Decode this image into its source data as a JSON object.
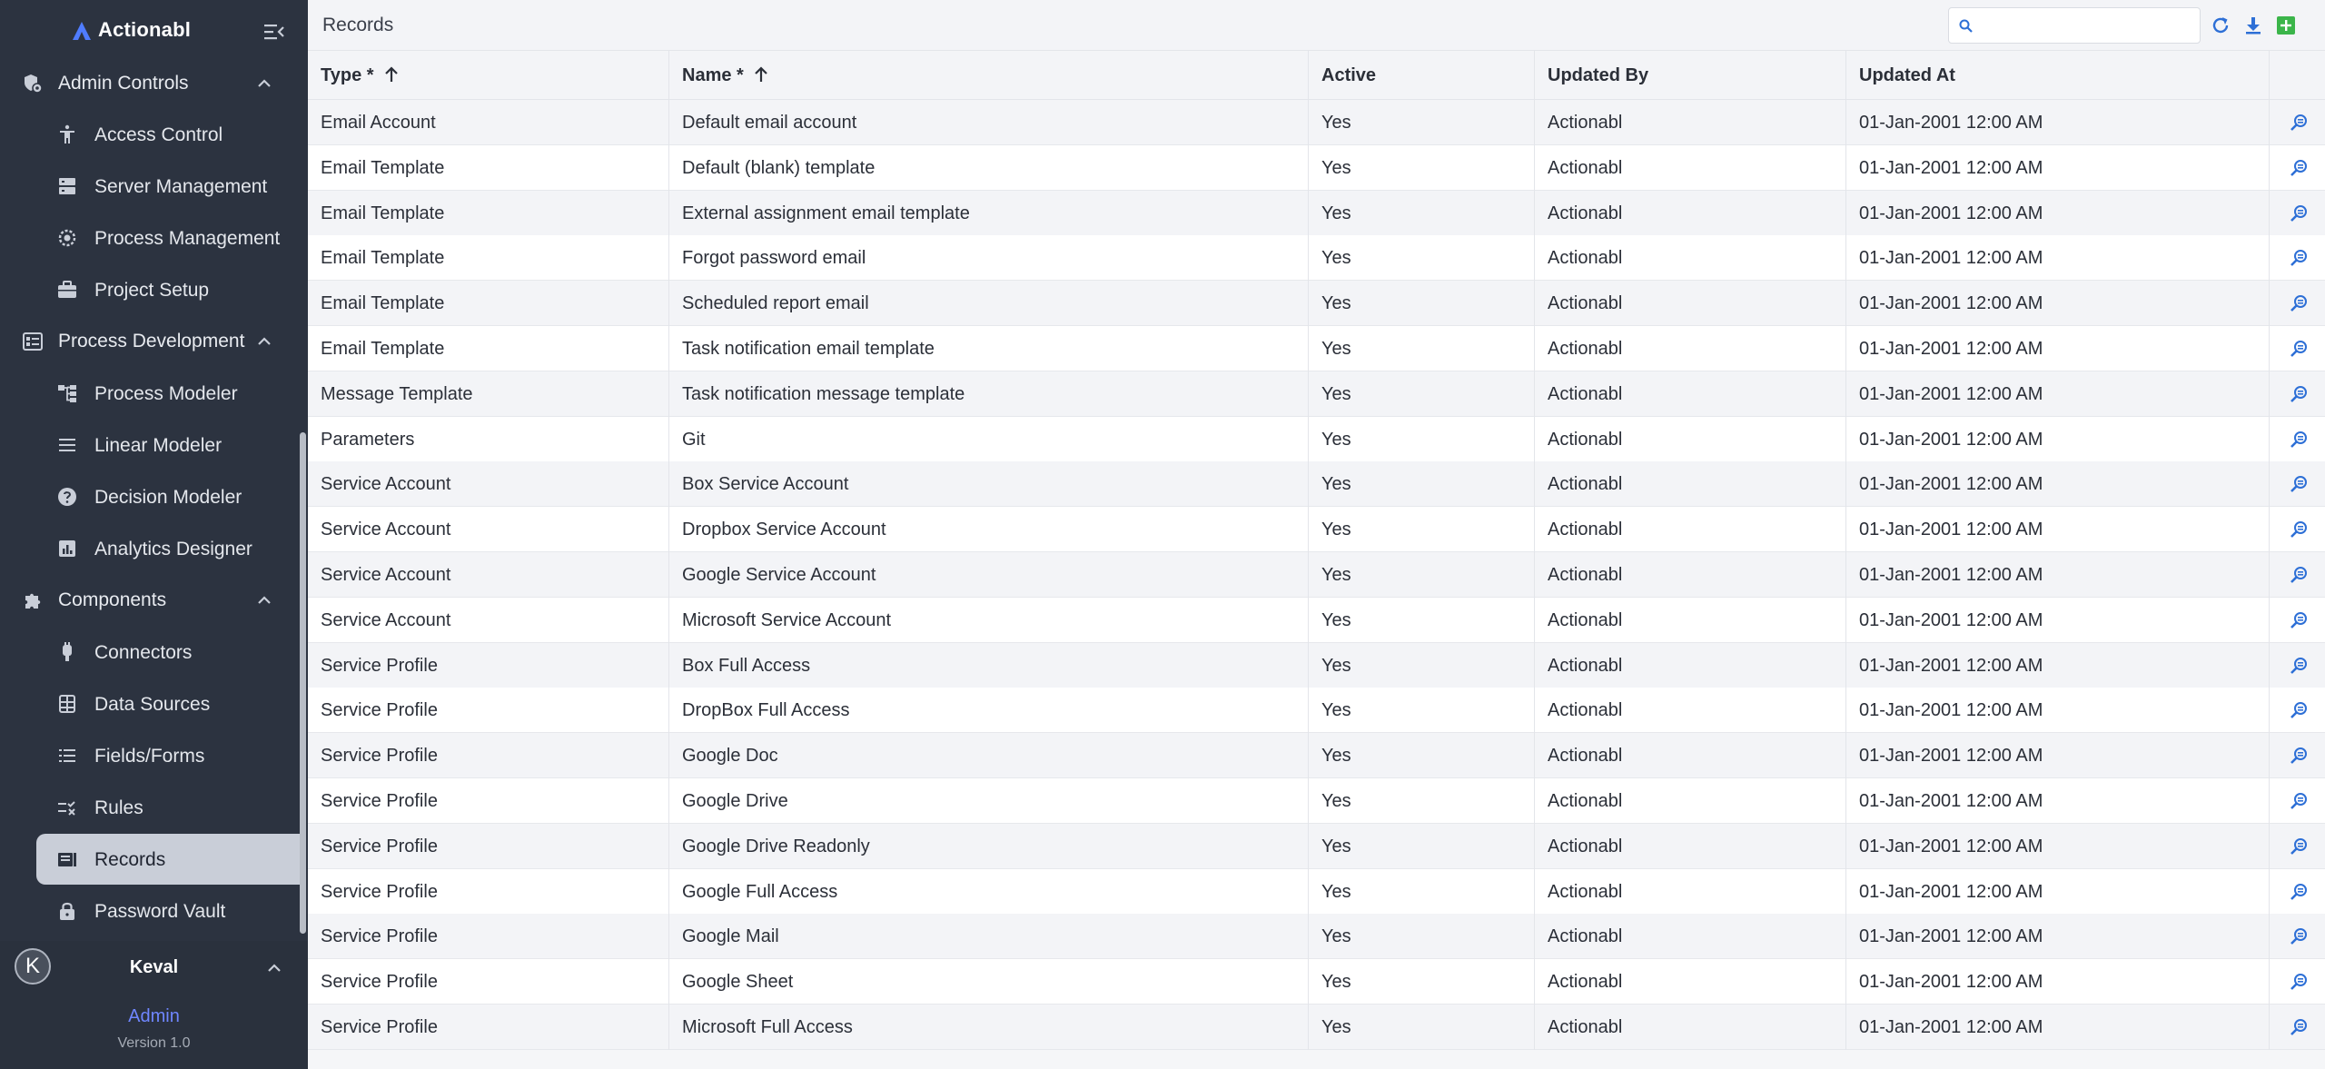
{
  "app": {
    "name": "Actionabl"
  },
  "sidebar": {
    "sections": [
      {
        "label": "Admin Controls",
        "icon": "admin-controls-icon",
        "items": [
          {
            "label": "Access Control",
            "icon": "accessibility-icon"
          },
          {
            "label": "Server Management",
            "icon": "server-icon"
          },
          {
            "label": "Process Management",
            "icon": "process-gear-icon"
          },
          {
            "label": "Project Setup",
            "icon": "briefcase-icon"
          }
        ]
      },
      {
        "label": "Process Development",
        "icon": "process-development-icon",
        "items": [
          {
            "label": "Process Modeler",
            "icon": "hierarchy-icon"
          },
          {
            "label": "Linear Modeler",
            "icon": "lines-icon"
          },
          {
            "label": "Decision Modeler",
            "icon": "help-circle-icon"
          },
          {
            "label": "Analytics Designer",
            "icon": "analytics-icon"
          }
        ]
      },
      {
        "label": "Components",
        "icon": "puzzle-icon",
        "items": [
          {
            "label": "Connectors",
            "icon": "plug-icon"
          },
          {
            "label": "Data Sources",
            "icon": "database-icon"
          },
          {
            "label": "Fields/Forms",
            "icon": "list-icon"
          },
          {
            "label": "Rules",
            "icon": "rule-icon"
          },
          {
            "label": "Records",
            "icon": "book-icon",
            "active": true
          },
          {
            "label": "Password Vault",
            "icon": "lock-icon"
          }
        ]
      }
    ],
    "user": {
      "initial": "K",
      "name": "Keval",
      "role": "Admin",
      "version": "Version 1.0"
    }
  },
  "header": {
    "title": "Records",
    "search": {
      "value": "",
      "placeholder": ""
    },
    "actions": [
      "refresh-icon",
      "download-icon",
      "add-icon"
    ]
  },
  "colors": {
    "sidebar_bg": "#2c3340",
    "accent_add": "#3bb54a",
    "accent_action": "#2d6fd6",
    "role": "#6f86ff"
  },
  "table": {
    "columns": [
      {
        "label": "Type *",
        "sortable": true,
        "sort": "asc"
      },
      {
        "label": "Name *",
        "sortable": true,
        "sort": "asc"
      },
      {
        "label": "Active"
      },
      {
        "label": "Updated By"
      },
      {
        "label": "Updated At"
      }
    ],
    "rows": [
      [
        "Email Account",
        "Default email account",
        "Yes",
        "Actionabl",
        "01-Jan-2001 12:00 AM"
      ],
      [
        "Email Template",
        "Default (blank) template",
        "Yes",
        "Actionabl",
        "01-Jan-2001 12:00 AM"
      ],
      [
        "Email Template",
        "External assignment email template",
        "Yes",
        "Actionabl",
        "01-Jan-2001 12:00 AM"
      ],
      [
        "Email Template",
        "Forgot password email",
        "Yes",
        "Actionabl",
        "01-Jan-2001 12:00 AM"
      ],
      [
        "Email Template",
        "Scheduled report email",
        "Yes",
        "Actionabl",
        "01-Jan-2001 12:00 AM"
      ],
      [
        "Email Template",
        "Task notification email template",
        "Yes",
        "Actionabl",
        "01-Jan-2001 12:00 AM"
      ],
      [
        "Message Template",
        "Task notification message template",
        "Yes",
        "Actionabl",
        "01-Jan-2001 12:00 AM"
      ],
      [
        "Parameters",
        "Git",
        "Yes",
        "Actionabl",
        "01-Jan-2001 12:00 AM"
      ],
      [
        "Service Account",
        "Box Service Account",
        "Yes",
        "Actionabl",
        "01-Jan-2001 12:00 AM"
      ],
      [
        "Service Account",
        "Dropbox Service Account",
        "Yes",
        "Actionabl",
        "01-Jan-2001 12:00 AM"
      ],
      [
        "Service Account",
        "Google Service Account",
        "Yes",
        "Actionabl",
        "01-Jan-2001 12:00 AM"
      ],
      [
        "Service Account",
        "Microsoft Service Account",
        "Yes",
        "Actionabl",
        "01-Jan-2001 12:00 AM"
      ],
      [
        "Service Profile",
        "Box Full Access",
        "Yes",
        "Actionabl",
        "01-Jan-2001 12:00 AM"
      ],
      [
        "Service Profile",
        "DropBox Full Access",
        "Yes",
        "Actionabl",
        "01-Jan-2001 12:00 AM"
      ],
      [
        "Service Profile",
        "Google Doc",
        "Yes",
        "Actionabl",
        "01-Jan-2001 12:00 AM"
      ],
      [
        "Service Profile",
        "Google Drive",
        "Yes",
        "Actionabl",
        "01-Jan-2001 12:00 AM"
      ],
      [
        "Service Profile",
        "Google Drive Readonly",
        "Yes",
        "Actionabl",
        "01-Jan-2001 12:00 AM"
      ],
      [
        "Service Profile",
        "Google Full Access",
        "Yes",
        "Actionabl",
        "01-Jan-2001 12:00 AM"
      ],
      [
        "Service Profile",
        "Google Mail",
        "Yes",
        "Actionabl",
        "01-Jan-2001 12:00 AM"
      ],
      [
        "Service Profile",
        "Google Sheet",
        "Yes",
        "Actionabl",
        "01-Jan-2001 12:00 AM"
      ],
      [
        "Service Profile",
        "Microsoft Full Access",
        "Yes",
        "Actionabl",
        "01-Jan-2001 12:00 AM"
      ]
    ],
    "row_action_icon": "view-details-icon"
  }
}
